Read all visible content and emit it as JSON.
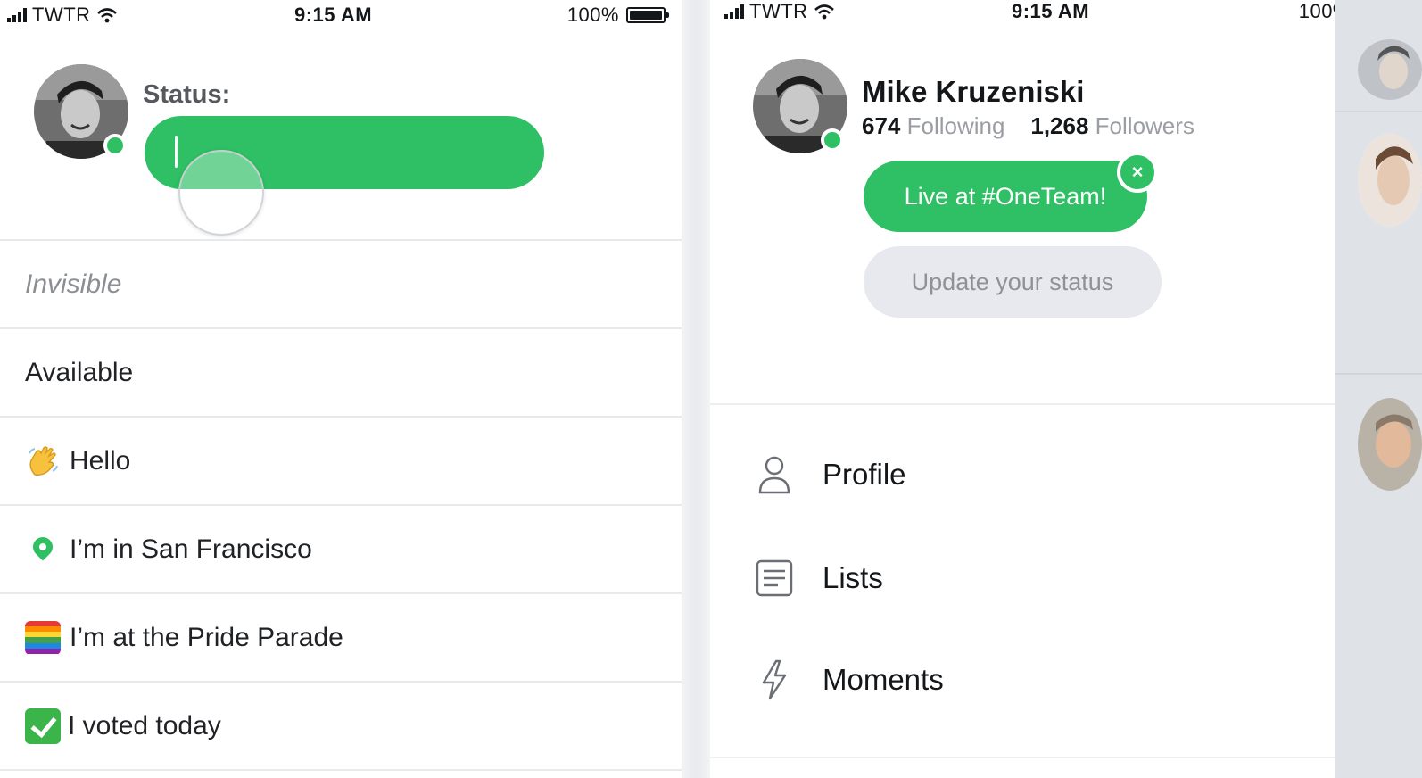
{
  "status_bar": {
    "carrier": "TWTR",
    "time": "9:15 AM",
    "battery": "100%"
  },
  "status_editor": {
    "label": "Status:",
    "input_value": ""
  },
  "status_options": [
    {
      "label": "Invisible",
      "icon": "none"
    },
    {
      "label": "Available",
      "icon": "none"
    },
    {
      "label": "Hello",
      "icon": "waving-hand-icon"
    },
    {
      "label": "I’m in San Francisco",
      "icon": "location-pin-icon"
    },
    {
      "label": "I’m at the Pride Parade",
      "icon": "rainbow-flag-icon"
    },
    {
      "label": "I voted today",
      "icon": "check-mark-icon"
    }
  ],
  "profile": {
    "name": "Mike Kruzeniski",
    "following_count": "674",
    "following_label": "Following",
    "followers_count": "1,268",
    "followers_label": "Followers",
    "live_status": "Live at #OneTeam!",
    "close_glyph": "×",
    "update_placeholder": "Update  your status"
  },
  "menu": [
    {
      "label": "Profile",
      "icon": "person-icon"
    },
    {
      "label": "Lists",
      "icon": "lists-icon"
    },
    {
      "label": "Moments",
      "icon": "lightning-icon"
    }
  ],
  "colors": {
    "accent_green": "#2fbf64",
    "pill_gray": "#e7e9ee",
    "divider": "#e8e9eb"
  }
}
